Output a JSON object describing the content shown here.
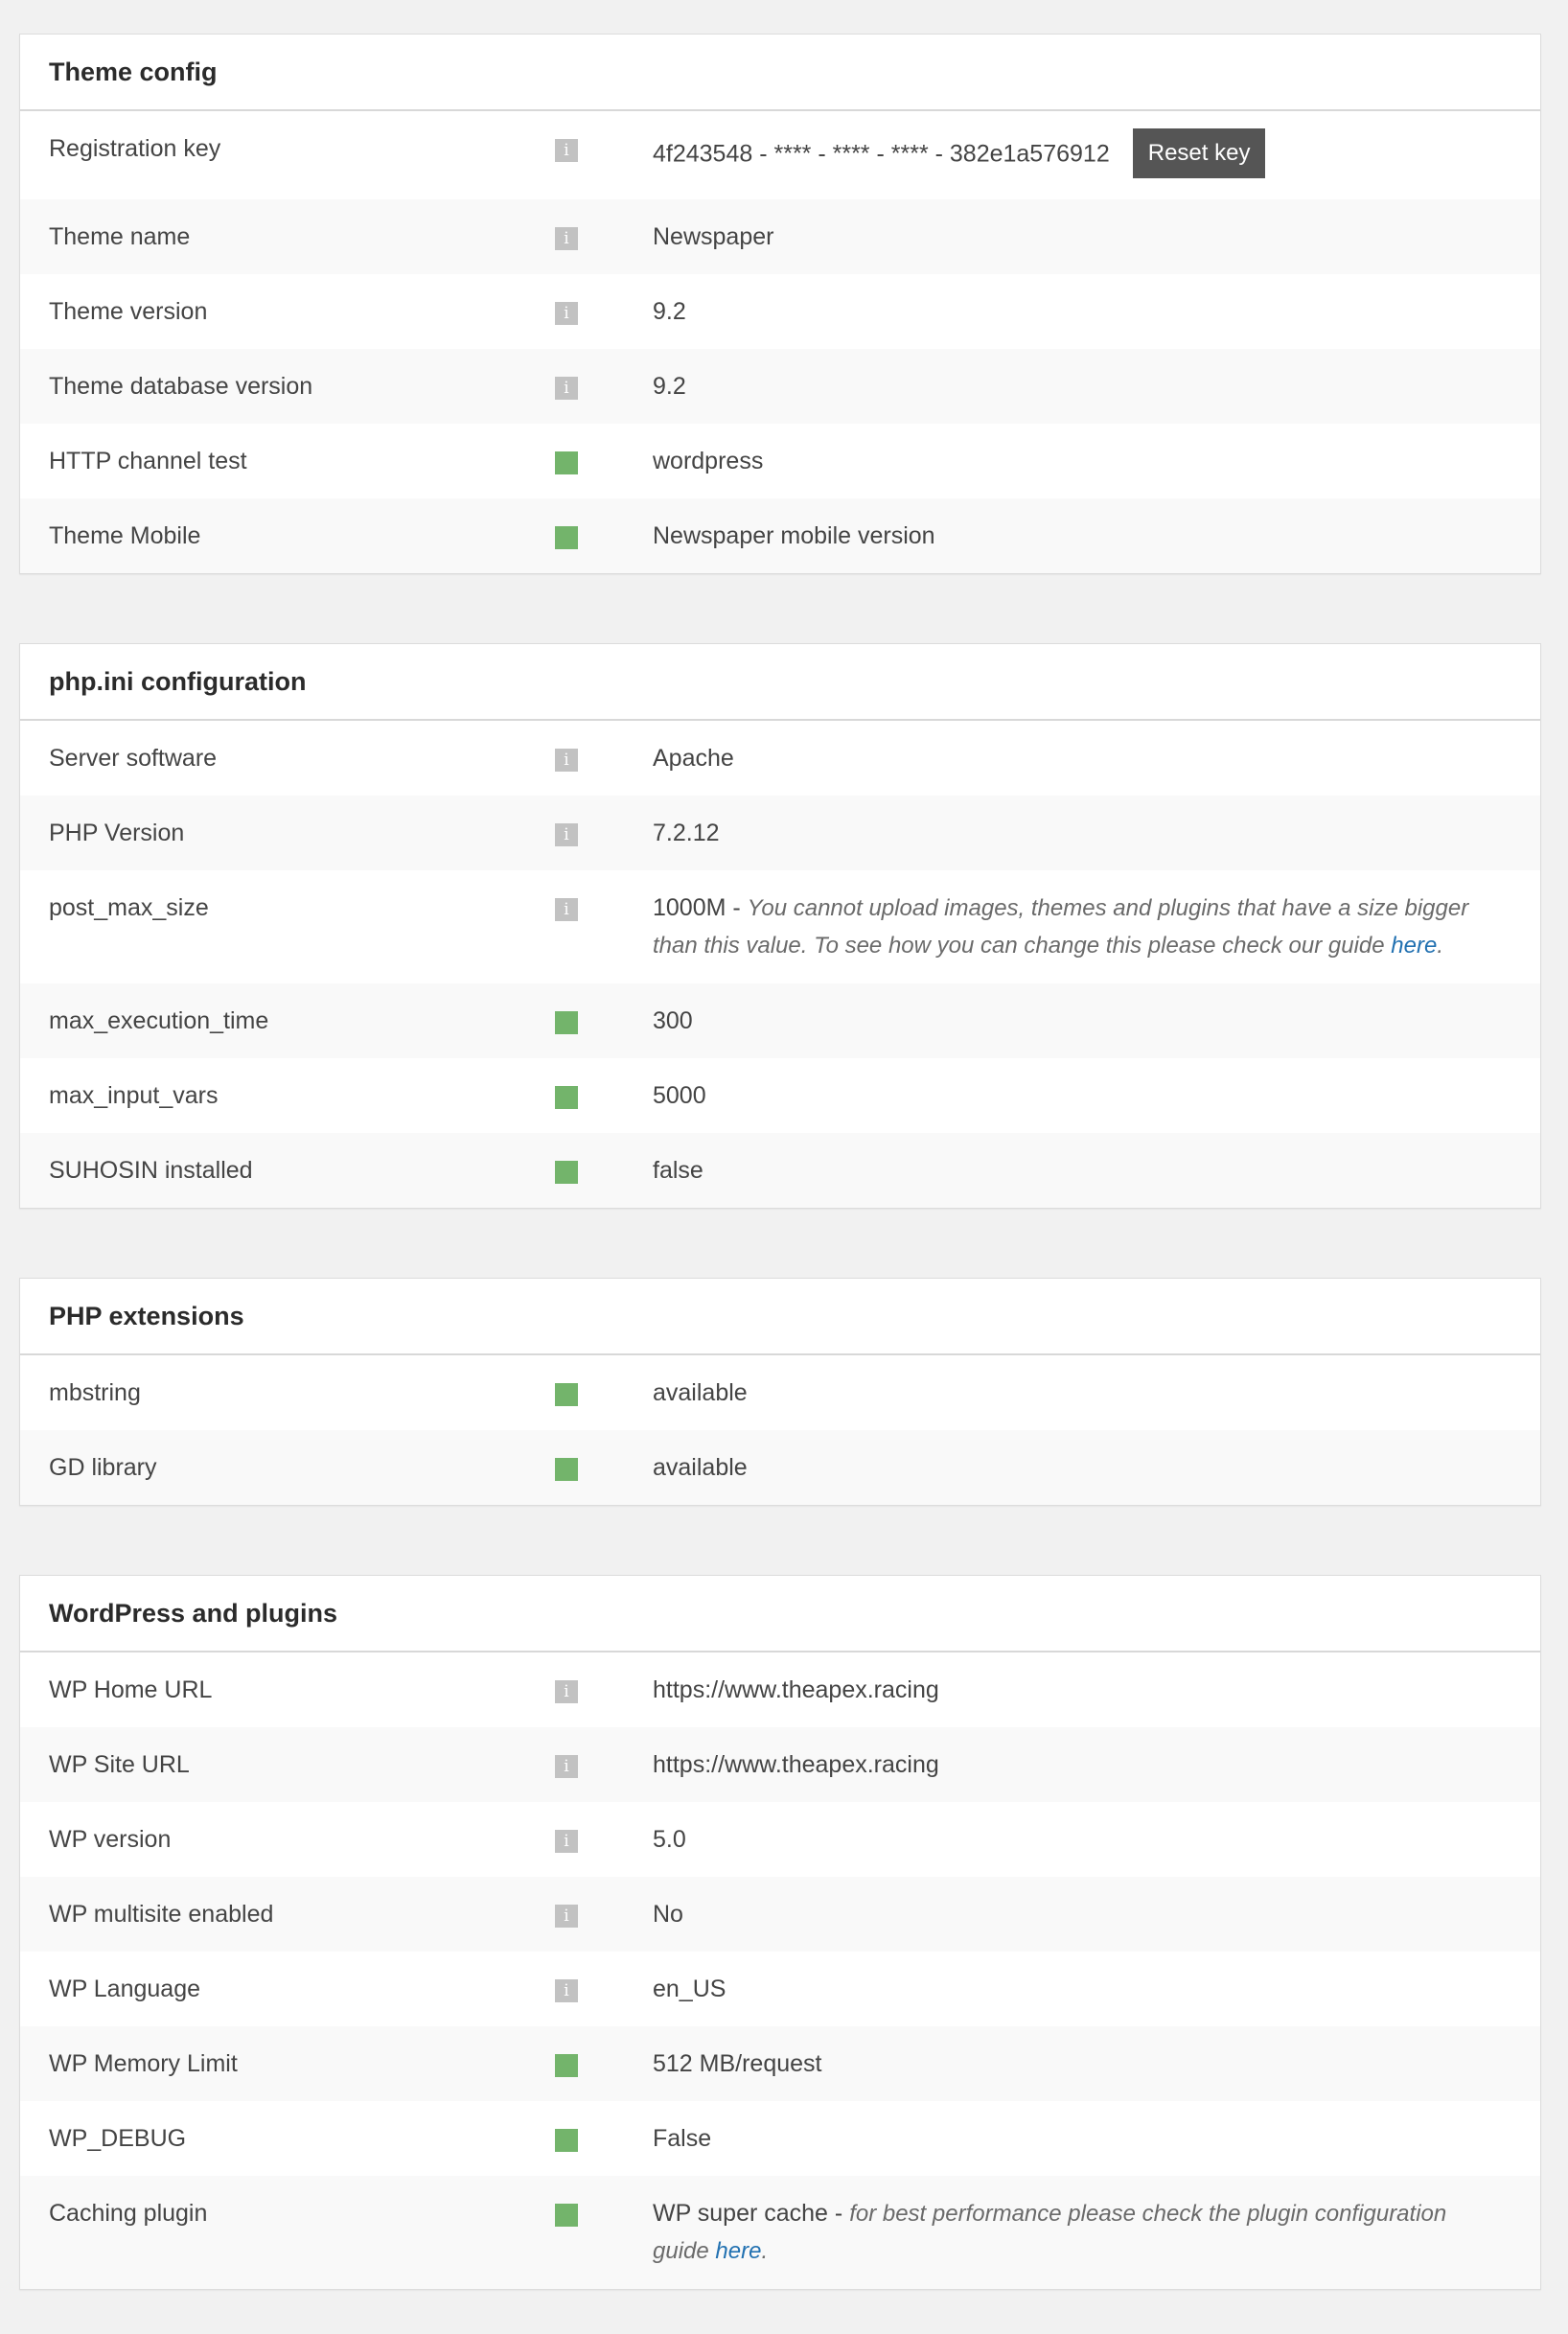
{
  "panels": [
    {
      "title": "Theme config",
      "rows": [
        {
          "label": "Registration key",
          "status": "info",
          "value": "4f243548 - **** - **** - **** - 382e1a576912",
          "button": "Reset key"
        },
        {
          "label": "Theme name",
          "status": "info",
          "value": "Newspaper"
        },
        {
          "label": "Theme version",
          "status": "info",
          "value": "9.2"
        },
        {
          "label": "Theme database version",
          "status": "info",
          "value": "9.2"
        },
        {
          "label": "HTTP channel test",
          "status": "ok",
          "value": "wordpress"
        },
        {
          "label": "Theme Mobile",
          "status": "ok",
          "value": "Newspaper mobile version"
        }
      ]
    },
    {
      "title": "php.ini configuration",
      "rows": [
        {
          "label": "Server software",
          "status": "info",
          "value": "Apache"
        },
        {
          "label": "PHP Version",
          "status": "info",
          "value": "7.2.12"
        },
        {
          "label": "post_max_size",
          "status": "info",
          "value": "1000M",
          "note": "You cannot upload images, themes and plugins that have a size bigger than this value. To see how you can change this please check our guide",
          "link": "here"
        },
        {
          "label": "max_execution_time",
          "status": "ok",
          "value": "300"
        },
        {
          "label": "max_input_vars",
          "status": "ok",
          "value": "5000"
        },
        {
          "label": "SUHOSIN installed",
          "status": "ok",
          "value": "false"
        }
      ]
    },
    {
      "title": "PHP extensions",
      "rows": [
        {
          "label": "mbstring",
          "status": "ok",
          "value": "available"
        },
        {
          "label": "GD library",
          "status": "ok",
          "value": "available"
        }
      ]
    },
    {
      "title": "WordPress and plugins",
      "rows": [
        {
          "label": "WP Home URL",
          "status": "info",
          "value": "https://www.theapex.racing"
        },
        {
          "label": "WP Site URL",
          "status": "info",
          "value": "https://www.theapex.racing"
        },
        {
          "label": "WP version",
          "status": "info",
          "value": "5.0"
        },
        {
          "label": "WP multisite enabled",
          "status": "info",
          "value": "No"
        },
        {
          "label": "WP Language",
          "status": "info",
          "value": "en_US"
        },
        {
          "label": "WP Memory Limit",
          "status": "ok",
          "value": "512 MB/request"
        },
        {
          "label": "WP_DEBUG",
          "status": "ok",
          "value": "False"
        },
        {
          "label": "Caching plugin",
          "status": "ok",
          "value": "WP super cache",
          "note": "for best performance please check the plugin configuration guide",
          "link": "here"
        }
      ]
    }
  ],
  "icons": {
    "info": "info-icon",
    "ok": "ok-status-icon",
    "info_glyph": "i"
  },
  "colors": {
    "ok": "#73b46b",
    "info": "#c2c2c2",
    "link": "#2271b1",
    "button": "#555555"
  },
  "text": {
    "separator": " - ",
    "period": "."
  }
}
